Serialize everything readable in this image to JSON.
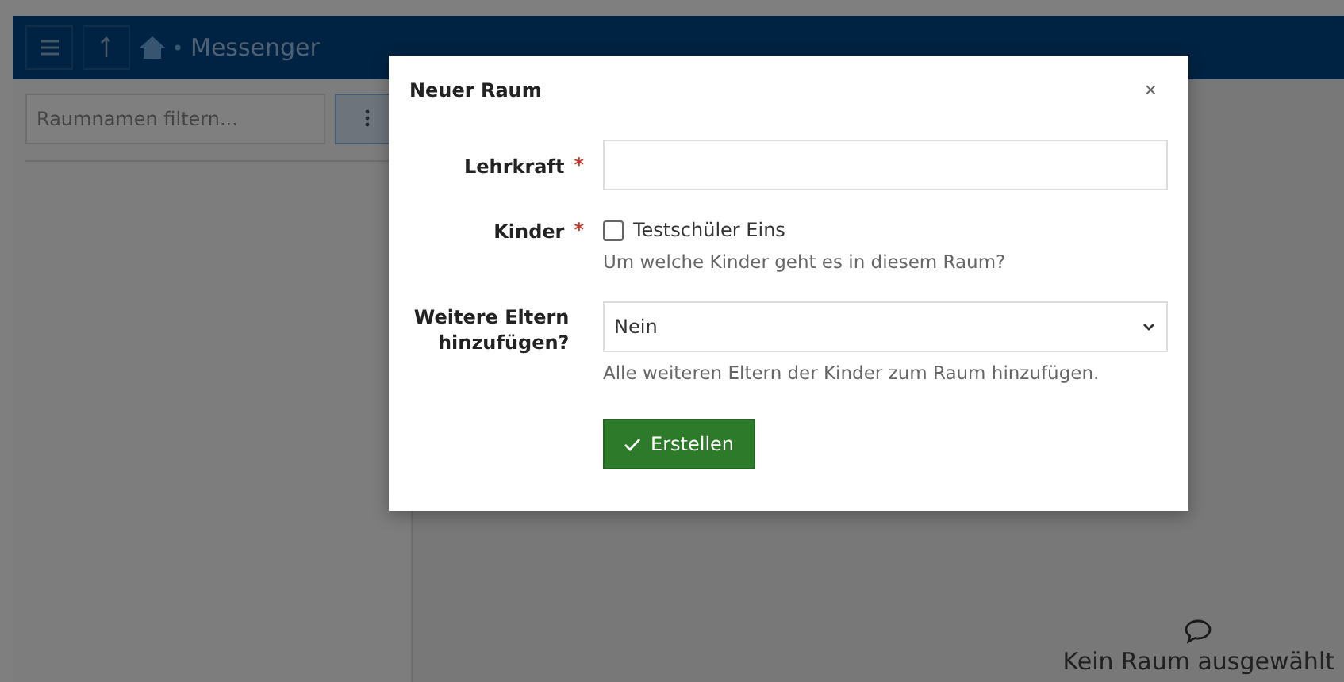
{
  "header": {
    "title": "Messenger"
  },
  "sidebar": {
    "filter": {
      "placeholder": "Raumnamen filtern..."
    }
  },
  "main": {
    "empty_text": "Kein Raum ausgewählt"
  },
  "dialog": {
    "title": "Neuer Raum",
    "close": "×",
    "required_mark": "*",
    "fields": [
      {
        "kind": "text",
        "label": "Lehrkraft",
        "required": true
      },
      {
        "kind": "checkbox",
        "label": "Kinder",
        "required": true,
        "option": "Testschüler Eins",
        "checked": false,
        "help": "Um welche Kinder geht es in diesem Raum?"
      },
      {
        "kind": "select",
        "label": "Weitere Eltern hinzufügen?",
        "required": false,
        "value": "Nein",
        "help": "Alle weiteren Eltern der Kinder zum Raum hinzufügen."
      }
    ],
    "submit": "Erstellen"
  }
}
